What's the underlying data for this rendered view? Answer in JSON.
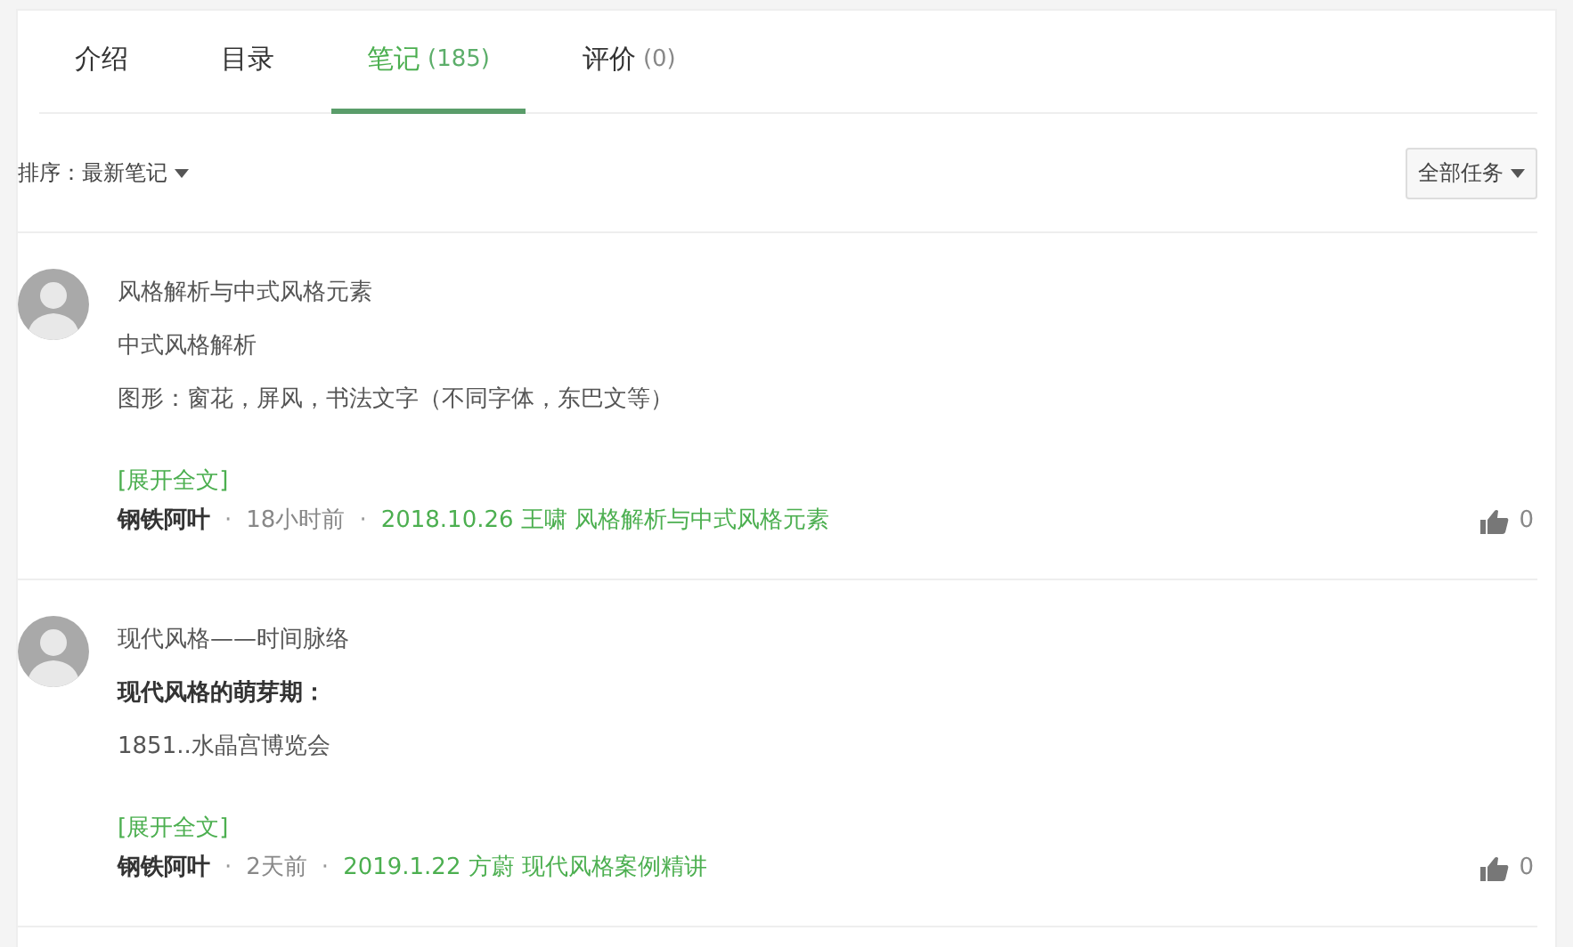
{
  "tabs": [
    {
      "label": "介绍",
      "selected": false
    },
    {
      "label": "目录",
      "selected": false
    },
    {
      "label": "笔记",
      "count": "(185)",
      "selected": true
    },
    {
      "label": "评价",
      "count": "(0)",
      "selected": false
    }
  ],
  "sort": {
    "label": "排序：",
    "value": "最新笔记"
  },
  "filter": {
    "label": "全部任务"
  },
  "notes": [
    {
      "title": "风格解析与中式风格元素",
      "lines": [
        {
          "text": "中式风格解析",
          "bold": false
        },
        {
          "text": "图形：窗花，屏风，书法文字（不同字体，东巴文等）",
          "bold": false
        }
      ],
      "expand": "[展开全文]",
      "author": "钢铁阿叶",
      "separators": [
        "·",
        "·"
      ],
      "time": "18小时前",
      "source": "2018.10.26 王啸 风格解析与中式风格元素",
      "likes": "0"
    },
    {
      "title": "现代风格——时间脉络",
      "lines": [
        {
          "text": "现代风格的萌芽期：",
          "bold": true
        },
        {
          "text": "1851..水晶宫博览会",
          "bold": false
        }
      ],
      "expand": "[展开全文]",
      "author": "钢铁阿叶",
      "separators": [
        "·",
        "·"
      ],
      "time": "2天前",
      "source": "2019.1.22 方蔚 现代风格案例精讲",
      "likes": "0"
    }
  ]
}
